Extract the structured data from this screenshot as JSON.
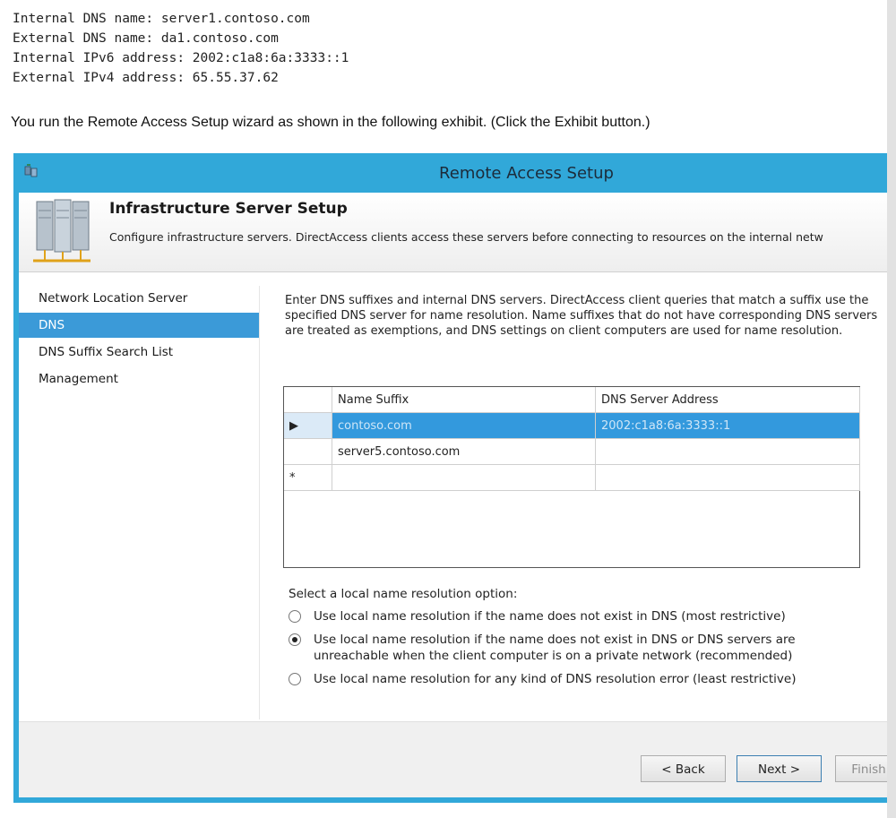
{
  "question": {
    "lines": [
      "Internal DNS name: server1.contoso.com",
      "External DNS name: da1.contoso.com",
      "Internal IPv6 address: 2002:c1a8:6a:3333::1",
      "External IPv4 address: 65.55.37.62"
    ],
    "intro": "You run the Remote Access Setup wizard as shown in the following exhibit. (Click the Exhibit button.)"
  },
  "window": {
    "title": "Remote Access Setup",
    "banner_title": "Infrastructure Server Setup",
    "banner_subtitle": "Configure infrastructure servers. DirectAccess clients access these servers before connecting to resources on the internal netw"
  },
  "nav": {
    "items": [
      {
        "label": "Network Location Server"
      },
      {
        "label": "DNS"
      },
      {
        "label": "DNS Suffix Search List"
      },
      {
        "label": "Management"
      }
    ],
    "active_index": 1
  },
  "dns": {
    "description": "Enter DNS suffixes and internal DNS servers.  DirectAccess client queries that match a suffix use the specified DNS server for name resolution. Name suffixes that do not have corresponding DNS servers are treated as exemptions, and DNS settings on client computers are used for name resolution.",
    "columns": [
      "Name Suffix",
      "DNS Server Address"
    ],
    "rows": [
      {
        "marker": "▶",
        "suffix": "contoso.com",
        "server": "2002:c1a8:6a:3333::1"
      },
      {
        "marker": "",
        "suffix": "server5.contoso.com",
        "server": ""
      },
      {
        "marker": "*",
        "suffix": "",
        "server": ""
      }
    ]
  },
  "resolution": {
    "label": "Select a local name resolution option:",
    "options": [
      {
        "label": "Use local name resolution if the name does not exist in DNS (most restrictive)"
      },
      {
        "label": "Use local name resolution if the name does not exist in DNS or DNS servers are unreachable when the client computer is on a private network (recommended)"
      },
      {
        "label": "Use local name resolution for any kind of DNS resolution error (least restrictive)"
      }
    ],
    "selected_index": 1
  },
  "buttons": {
    "back": "< Back",
    "next": "Next >",
    "finish": "Finish"
  },
  "colors": {
    "titlebar": "#31a8d9",
    "selection": "#3399dd"
  }
}
